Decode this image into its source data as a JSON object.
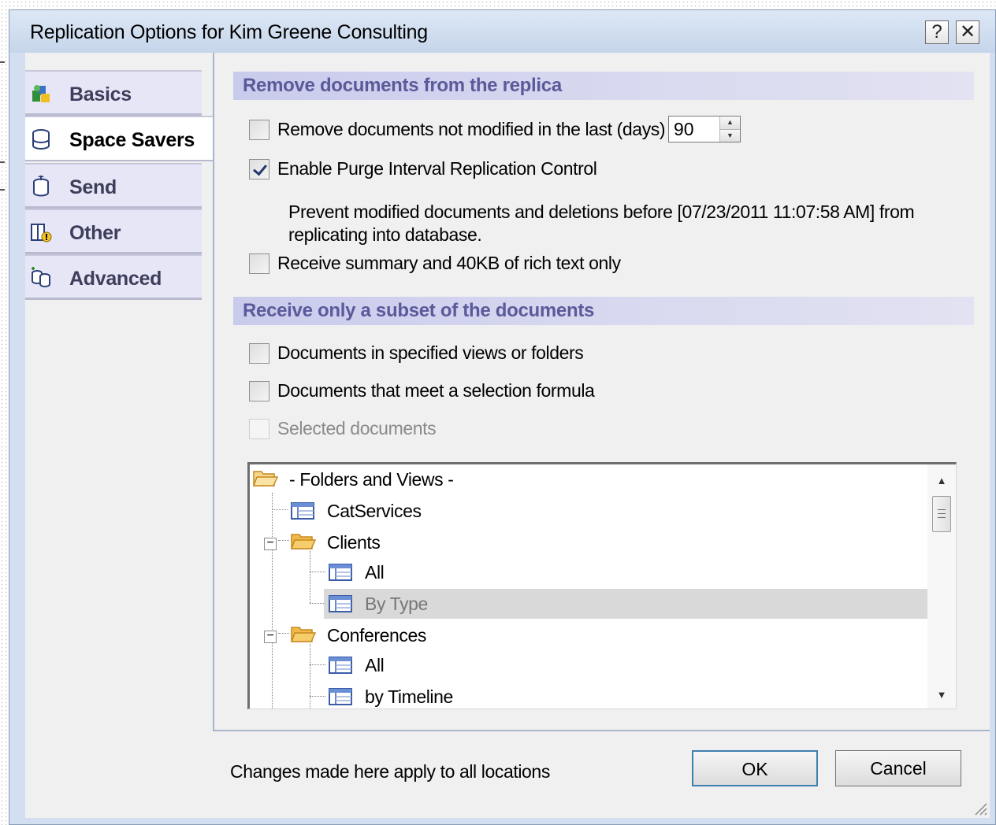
{
  "window": {
    "title": "Replication Options for Kim Greene Consulting",
    "help_label": "?",
    "close_label": "✕"
  },
  "sidebar": {
    "items": [
      {
        "label": "Basics",
        "icon": "basics-icon",
        "active": false
      },
      {
        "label": "Space Savers",
        "icon": "space-savers-icon",
        "active": true
      },
      {
        "label": "Send",
        "icon": "send-icon",
        "active": false
      },
      {
        "label": "Other",
        "icon": "other-icon",
        "active": false
      },
      {
        "label": "Advanced",
        "icon": "advanced-icon",
        "active": false
      }
    ]
  },
  "remove_section": {
    "header": "Remove documents from the replica",
    "not_modified": {
      "label": "Remove documents not modified in the last (days)",
      "checked": false,
      "days": "90"
    },
    "purge_interval": {
      "label": "Enable Purge Interval Replication Control",
      "checked": true
    },
    "purge_note": "Prevent modified documents and deletions before [07/23/2011 11:07:58 AM] from replicating into database.",
    "summary_only": {
      "label": "Receive summary and 40KB of rich text only",
      "checked": false
    }
  },
  "subset_section": {
    "header": "Receive only a subset of the documents",
    "views_folders": {
      "label": "Documents in specified views or folders",
      "checked": false
    },
    "selection_formula": {
      "label": "Documents that meet a selection formula",
      "checked": false
    },
    "selected_docs": {
      "label": "Selected documents",
      "checked": false,
      "disabled": true
    }
  },
  "tree": {
    "root": "- Folders and Views -",
    "cat_services": "CatServices",
    "clients": "Clients",
    "clients_all": "All",
    "clients_by_type": "By Type",
    "conferences": "Conferences",
    "conferences_all": "All",
    "conferences_by_timeline": "by Timeline"
  },
  "footer": {
    "note": "Changes made here apply to all locations",
    "ok_label": "OK",
    "cancel_label": "Cancel"
  },
  "colors": {
    "title_bar": "#c6d5ea",
    "section_header": "#d6d7f0",
    "section_header_text": "#5a5a9a",
    "ok_border": "#3c7fb1"
  }
}
